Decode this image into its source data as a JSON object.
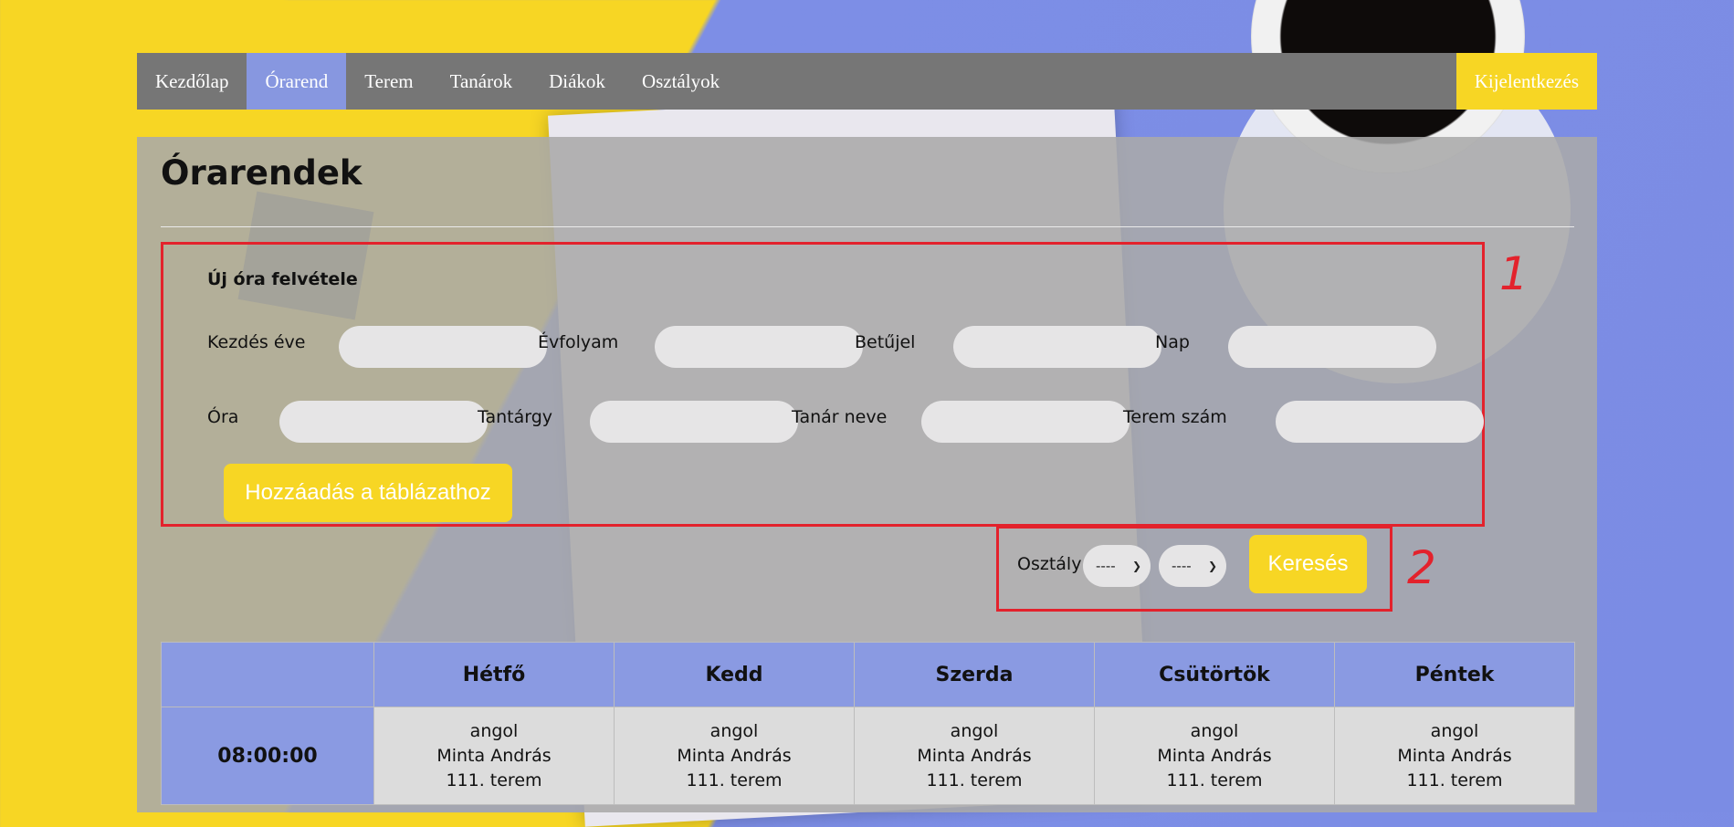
{
  "nav": {
    "items": [
      {
        "label": "Kezdőlap",
        "active": false
      },
      {
        "label": "Órarend",
        "active": true
      },
      {
        "label": "Terem",
        "active": false
      },
      {
        "label": "Tanárok",
        "active": false
      },
      {
        "label": "Diákok",
        "active": false
      },
      {
        "label": "Osztályok",
        "active": false
      }
    ],
    "logout": "Kijelentkezés"
  },
  "page": {
    "title": "Órarendek"
  },
  "form": {
    "title": "Új óra felvétele",
    "fields": {
      "start_year": "Kezdés éve",
      "grade": "Évfolyam",
      "letter": "Betűjel",
      "day": "Nap",
      "hour": "Óra",
      "subject": "Tantárgy",
      "teacher": "Tanár neve",
      "room": "Terem szám"
    },
    "submit": "Hozzáadás a táblázathoz",
    "marker": "1"
  },
  "search": {
    "label": "Osztály",
    "select1": "----",
    "select2": "----",
    "button": "Keresés",
    "marker": "2"
  },
  "timetable": {
    "days": [
      "Hétfő",
      "Kedd",
      "Szerda",
      "Csütörtök",
      "Péntek"
    ],
    "rows": [
      {
        "time": "08:00:00",
        "cells": [
          {
            "subject": "angol",
            "teacher": "Minta András",
            "room": "111. terem"
          },
          {
            "subject": "angol",
            "teacher": "Minta András",
            "room": "111. terem"
          },
          {
            "subject": "angol",
            "teacher": "Minta András",
            "room": "111. terem"
          },
          {
            "subject": "angol",
            "teacher": "Minta András",
            "room": "111. terem"
          },
          {
            "subject": "angol",
            "teacher": "Minta András",
            "room": "111. terem"
          }
        ]
      }
    ]
  },
  "colors": {
    "accent_yellow": "#f7d624",
    "accent_blue": "#8797e0",
    "nav_gray": "#767676",
    "marker_red": "#e3222c"
  }
}
